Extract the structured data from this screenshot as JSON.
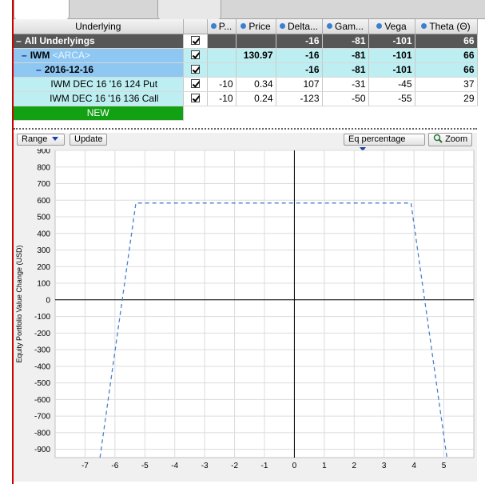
{
  "table": {
    "headers": [
      {
        "key": "underlying",
        "label": "Underlying",
        "dot": false
      },
      {
        "key": "check",
        "label": "",
        "dot": false
      },
      {
        "key": "position",
        "label": "P...",
        "dot": true
      },
      {
        "key": "price",
        "label": "Price",
        "dot": true
      },
      {
        "key": "delta",
        "label": "Delta...",
        "dot": true
      },
      {
        "key": "gamma",
        "label": "Gam...",
        "dot": true
      },
      {
        "key": "vega",
        "label": "Vega",
        "dot": true
      },
      {
        "key": "theta",
        "label": "Theta (Θ)",
        "dot": true
      }
    ],
    "rows": [
      {
        "name": "All Underlyings",
        "suffix": "",
        "position": "",
        "price": "",
        "delta": "-16",
        "gamma": "-81",
        "vega": "-101",
        "theta": "66"
      },
      {
        "name": "IWM",
        "suffix": "<ARCA>",
        "position": "",
        "price": "130.97",
        "delta": "-16",
        "gamma": "-81",
        "vega": "-101",
        "theta": "66"
      },
      {
        "name": "2016-12-16",
        "suffix": "",
        "position": "",
        "price": "",
        "delta": "-16",
        "gamma": "-81",
        "vega": "-101",
        "theta": "66"
      },
      {
        "name": "IWM DEC 16 '16 124 Put",
        "suffix": "",
        "position": "-10",
        "price": "0.34",
        "delta": "107",
        "gamma": "-31",
        "vega": "-45",
        "theta": "37"
      },
      {
        "name": "IWM DEC 16 '16 136 Call",
        "suffix": "",
        "position": "-10",
        "price": "0.24",
        "delta": "-123",
        "gamma": "-50",
        "vega": "-55",
        "theta": "29"
      }
    ],
    "new_label": "NEW",
    "dash_glyph": "–"
  },
  "toolbar": {
    "range_label": "Range",
    "update_label": "Update",
    "mode_label": "Eq percentage",
    "zoom_label": "Zoom"
  },
  "colors": {
    "accent_red": "#cc0000",
    "line_blue": "#4a7fd0",
    "row_all": "#575757",
    "row_iwm": "#8ec7f2",
    "row_cyan": "#bdeff2",
    "new_green": "#12a112"
  },
  "chart_data": {
    "type": "line",
    "ylabel": "Equity Portfolio Value Change (USD)",
    "xlim": [
      -8,
      6
    ],
    "ylim": [
      -950,
      900
    ],
    "x_ticks": [
      -7,
      -6,
      -5,
      -4,
      -3,
      -2,
      -1,
      0,
      1,
      2,
      3,
      4,
      5
    ],
    "y_ticks": [
      900,
      800,
      700,
      600,
      500,
      400,
      300,
      200,
      100,
      0,
      -100,
      -200,
      -300,
      -400,
      -500,
      -600,
      -700,
      -800,
      -900
    ],
    "grid": true,
    "series": [
      {
        "style": "dashed",
        "x": [
          -6.5,
          -5.3,
          3.9,
          5.1
        ],
        "y": [
          -950,
          583,
          583,
          -950
        ]
      }
    ]
  }
}
